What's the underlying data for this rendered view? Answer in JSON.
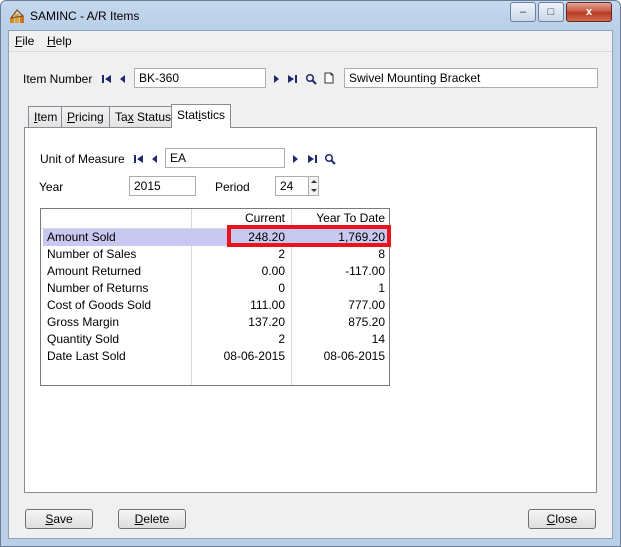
{
  "window": {
    "title": "SAMINC - A/R Items",
    "minimize_glyph": "–",
    "maximize_glyph": "□",
    "close_glyph": "x"
  },
  "menu": {
    "file_underline": "F",
    "file_rest": "ile",
    "help_underline": "H",
    "help_rest": "elp"
  },
  "item": {
    "label": "Item Number",
    "number": "BK-360",
    "description": "Swivel Mounting Bracket"
  },
  "tabs": {
    "item_u": "I",
    "item_rest": "tem",
    "pricing_u": "P",
    "pricing_rest": "ricing",
    "tax_pre": "Ta",
    "tax_u": "x",
    "tax_rest": " Status",
    "statistics_pre": "Stat",
    "statistics_u": "i",
    "statistics_rest": "stics"
  },
  "statistics": {
    "uom_label": "Unit of Measure",
    "uom_value": "EA",
    "year_label": "Year",
    "year_value": "2015",
    "period_label": "Period",
    "period_value": "24",
    "columns": {
      "current": "Current",
      "ytd": "Year To Date"
    },
    "rows": [
      {
        "label": "Amount Sold",
        "current": "248.20",
        "ytd": "1,769.20"
      },
      {
        "label": "Number of Sales",
        "current": "2",
        "ytd": "8"
      },
      {
        "label": "Amount Returned",
        "current": "0.00",
        "ytd": "-117.00"
      },
      {
        "label": "Number of Returns",
        "current": "0",
        "ytd": "1"
      },
      {
        "label": "Cost of Goods Sold",
        "current": "111.00",
        "ytd": "777.00"
      },
      {
        "label": "Gross Margin",
        "current": "137.20",
        "ytd": "875.20"
      },
      {
        "label": "Quantity Sold",
        "current": "2",
        "ytd": "14"
      },
      {
        "label": "Date Last Sold",
        "current": "08-06-2015",
        "ytd": "08-06-2015"
      }
    ]
  },
  "buttons": {
    "save_u": "S",
    "save_rest": "ave",
    "delete_u": "D",
    "delete_rest": "elete",
    "close_u": "C",
    "close_rest": "lose"
  },
  "icons": {
    "first": "first-record-icon",
    "prev": "previous-record-icon",
    "next": "next-record-icon",
    "last": "last-record-icon",
    "find": "search-icon",
    "new": "new-document-icon",
    "app": "app-icon"
  },
  "colors": {
    "highlight_row": "#c8c8f0",
    "annotation_box": "#e8141c",
    "nav_arrow": "#1f2a6b"
  }
}
